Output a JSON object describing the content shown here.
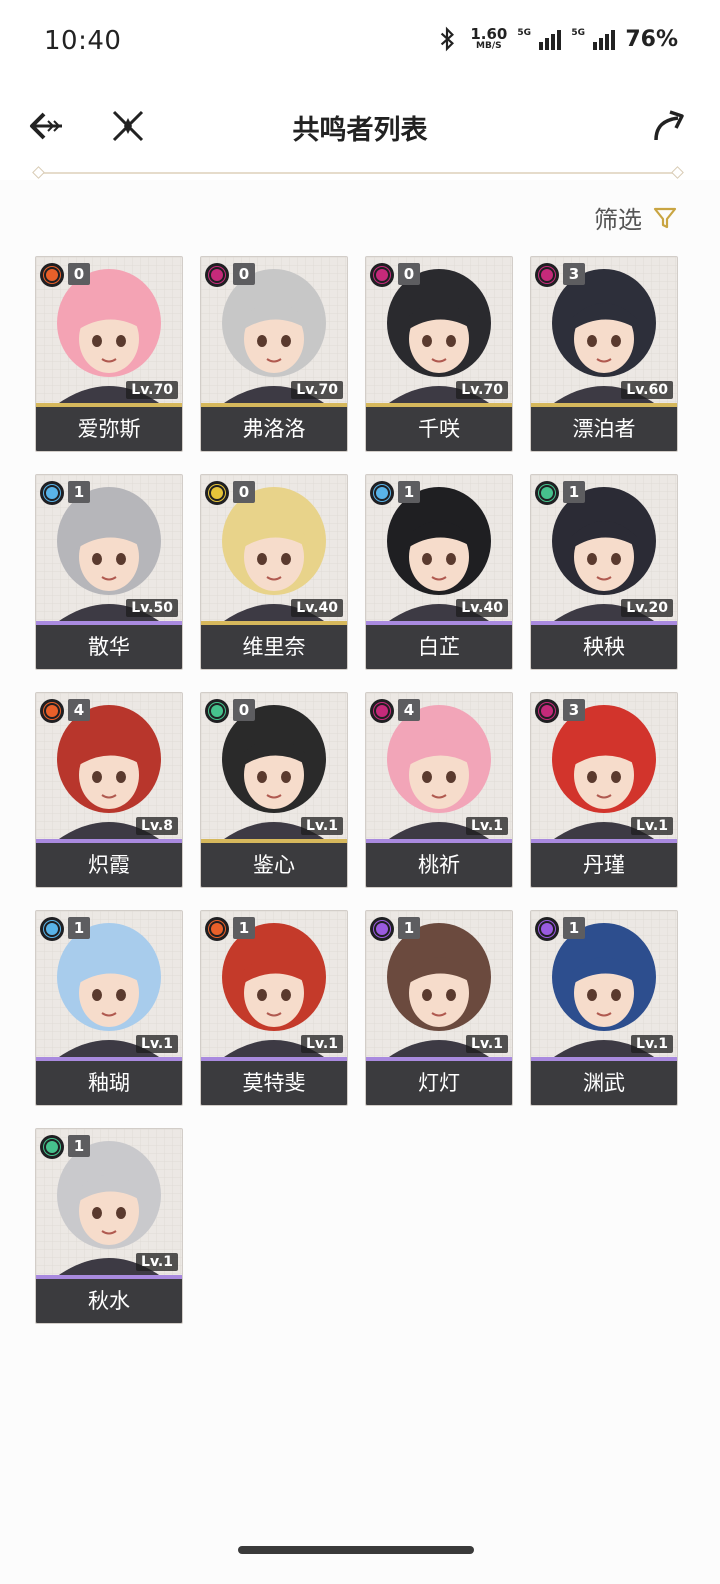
{
  "status": {
    "time": "10:40",
    "speed_value": "1.60",
    "speed_unit": "MB/S",
    "sim1_tag": "5G",
    "sim2_tag": "5G",
    "battery": "76%"
  },
  "header": {
    "title": "共鸣者列表",
    "back_icon": "back-arrow-icon",
    "close_icon": "crossed-swords-icon",
    "share_icon": "share-arrow-icon"
  },
  "filter": {
    "label": "筛选",
    "icon": "funnel-icon"
  },
  "colors": {
    "gold": "#d6b85c",
    "purple": "#a98adf",
    "card_footer": "#3b3b3e"
  },
  "elements": {
    "fire": "#e8602a",
    "spectro": "#e6c43a",
    "glacio": "#59b3e8",
    "aero": "#46c28d",
    "havoc": "#c52a7a",
    "electro": "#9a5be0"
  },
  "characters": [
    {
      "name": "爱弥斯",
      "level": "Lv.70",
      "seq": "0",
      "element": "fire",
      "rarity": "gold"
    },
    {
      "name": "弗洛洛",
      "level": "Lv.70",
      "seq": "0",
      "element": "havoc",
      "rarity": "gold"
    },
    {
      "name": "千咲",
      "level": "Lv.70",
      "seq": "0",
      "element": "havoc",
      "rarity": "gold"
    },
    {
      "name": "漂泊者",
      "level": "Lv.60",
      "seq": "3",
      "element": "havoc",
      "rarity": "gold"
    },
    {
      "name": "散华",
      "level": "Lv.50",
      "seq": "1",
      "element": "glacio",
      "rarity": "purple"
    },
    {
      "name": "维里奈",
      "level": "Lv.40",
      "seq": "0",
      "element": "spectro",
      "rarity": "gold"
    },
    {
      "name": "白芷",
      "level": "Lv.40",
      "seq": "1",
      "element": "glacio",
      "rarity": "purple"
    },
    {
      "name": "秧秧",
      "level": "Lv.20",
      "seq": "1",
      "element": "aero",
      "rarity": "purple"
    },
    {
      "name": "炽霞",
      "level": "Lv.8",
      "seq": "4",
      "element": "fire",
      "rarity": "purple"
    },
    {
      "name": "鉴心",
      "level": "Lv.1",
      "seq": "0",
      "element": "aero",
      "rarity": "gold"
    },
    {
      "name": "桃祈",
      "level": "Lv.1",
      "seq": "4",
      "element": "havoc",
      "rarity": "purple"
    },
    {
      "name": "丹瑾",
      "level": "Lv.1",
      "seq": "3",
      "element": "havoc",
      "rarity": "purple"
    },
    {
      "name": "釉瑚",
      "level": "Lv.1",
      "seq": "1",
      "element": "glacio",
      "rarity": "purple"
    },
    {
      "name": "莫特斐",
      "level": "Lv.1",
      "seq": "1",
      "element": "fire",
      "rarity": "purple"
    },
    {
      "name": "灯灯",
      "level": "Lv.1",
      "seq": "1",
      "element": "electro",
      "rarity": "purple"
    },
    {
      "name": "渊武",
      "level": "Lv.1",
      "seq": "1",
      "element": "electro",
      "rarity": "purple"
    },
    {
      "name": "秋水",
      "level": "Lv.1",
      "seq": "1",
      "element": "aero",
      "rarity": "purple"
    }
  ]
}
